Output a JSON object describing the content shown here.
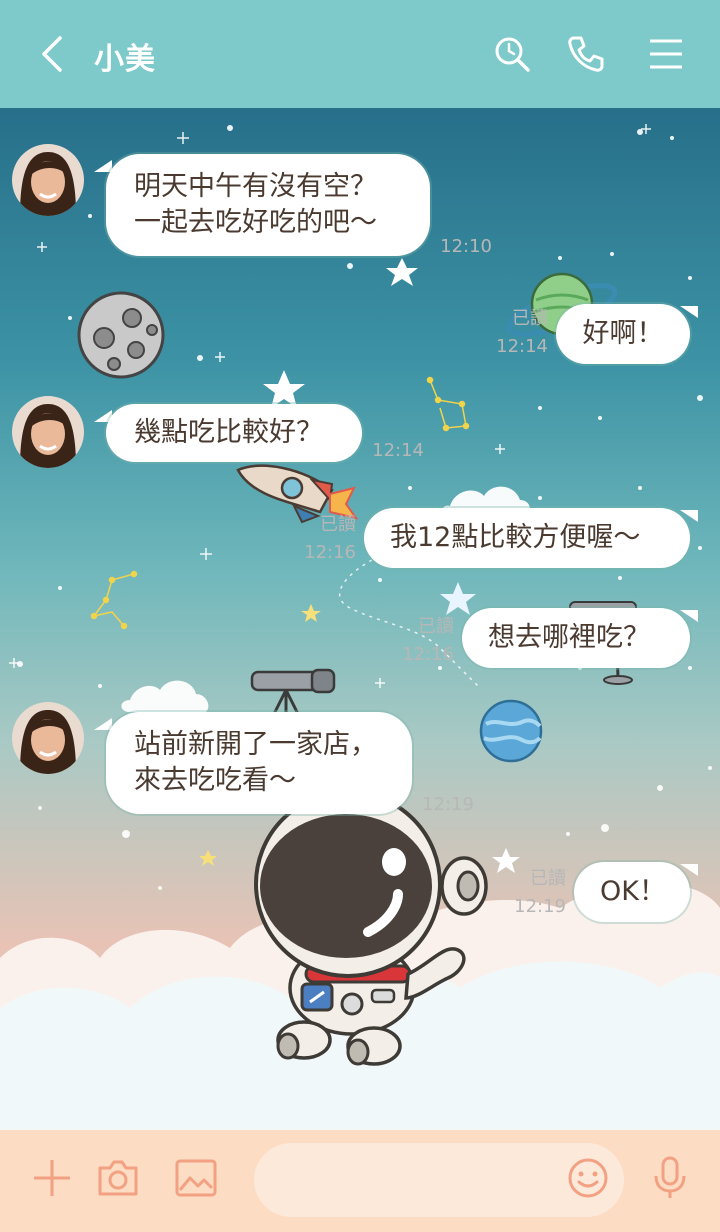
{
  "header": {
    "title": "小美",
    "bg_color": "#7ec9c9"
  },
  "messages": [
    {
      "side": "in",
      "text": "明天中午有沒有空？\n一起去吃好吃的吧～",
      "time": "12:10"
    },
    {
      "side": "out",
      "text": "好啊！",
      "read": "已讀",
      "time": "12:14"
    },
    {
      "side": "in",
      "text": "幾點吃比較好？",
      "time": "12:14"
    },
    {
      "side": "out",
      "text": "我12點比較方便喔～",
      "read": "已讀",
      "time": "12:16"
    },
    {
      "side": "out",
      "text": "想去哪裡吃？",
      "read": "已讀",
      "time": "12:16"
    },
    {
      "side": "in",
      "text": "站前新開了一家店，\n來去吃吃看～",
      "time": "12:19"
    },
    {
      "side": "out",
      "text": "OK！",
      "read": "已讀",
      "time": "12:19"
    }
  ],
  "icons": {
    "header": [
      "back-arrow-icon",
      "search-icon",
      "phone-icon",
      "menu-icon"
    ],
    "inputbar": [
      "plus-icon",
      "camera-icon",
      "image-icon",
      "emoji-icon",
      "microphone-icon"
    ]
  },
  "input": {
    "placeholder": ""
  },
  "colors": {
    "input_bar": "#fcdcc3",
    "bubble_text": "#4a3a30",
    "timestamp": "#b7b7b7"
  }
}
